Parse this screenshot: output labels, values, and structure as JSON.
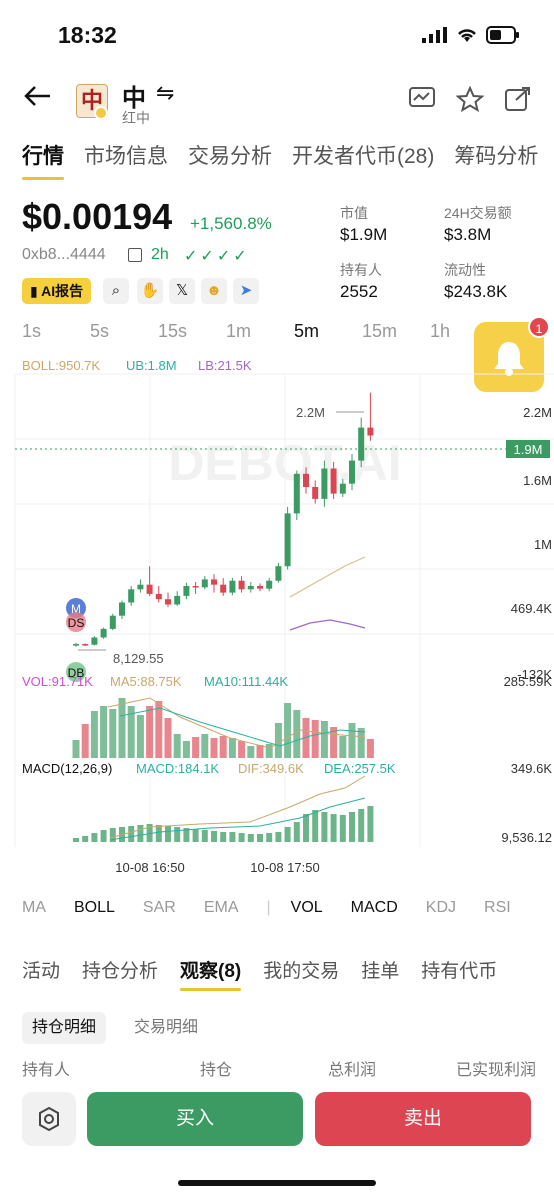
{
  "status": {
    "time": "18:32"
  },
  "header": {
    "token_name": "中",
    "token_sub": "红中",
    "logo_char": "中"
  },
  "main_tabs": [
    "行情",
    "市场信息",
    "交易分析",
    "开发者代币(28)",
    "筹码分析"
  ],
  "price": {
    "value": "$0.00194",
    "change": "+1,560.8%",
    "address": "0xb8...4444",
    "age": "2h",
    "checks": "✓✓✓✓"
  },
  "stats": {
    "market_cap_label": "市值",
    "market_cap": "$1.9M",
    "volume_label": "24H交易额",
    "volume": "$3.8M",
    "holders_label": "持有人",
    "holders": "2552",
    "liquidity_label": "流动性",
    "liquidity": "$243.8K"
  },
  "tools": {
    "ai_label": "AI报告"
  },
  "intervals": [
    "1s",
    "5s",
    "15s",
    "1m",
    "5m",
    "15m",
    "1h"
  ],
  "active_interval": "5m",
  "notification_count": "1",
  "chart_data": {
    "type": "candlestick",
    "watermark": "DEBOT.AI",
    "boll_label": "BOLL:950.7K",
    "ub_label": "UB:1.8M",
    "lb_label": "LB:21.5K",
    "y_ticks": [
      "2.2M",
      "1.6M",
      "1M",
      "469.4K",
      "-132K"
    ],
    "current_price": "1.9M",
    "high_marker": "2.2M",
    "low_marker": "8,129.55",
    "vol_label": "VOL:91.71K",
    "ma5_label": "MA5:88.75K",
    "ma10_label": "MA10:111.44K",
    "vol_max": "285.59K",
    "macd_label": "MACD(12,26,9)",
    "macd_val": "MACD:184.1K",
    "dif_val": "DIF:349.6K",
    "dea_val": "DEA:257.5K",
    "macd_top": "349.6K",
    "macd_bottom": "9,536.12",
    "x_labels": [
      "10-08 16:50",
      "10-08 17:50"
    ],
    "candles": [
      [
        10,
        12,
        8,
        14
      ],
      [
        12,
        11,
        9,
        13
      ],
      [
        11,
        22,
        10,
        24
      ],
      [
        22,
        35,
        20,
        37
      ],
      [
        35,
        55,
        33,
        58
      ],
      [
        55,
        75,
        50,
        78
      ],
      [
        75,
        95,
        70,
        100
      ],
      [
        95,
        102,
        90,
        110
      ],
      [
        102,
        88,
        85,
        130
      ],
      [
        88,
        80,
        75,
        100
      ],
      [
        80,
        72,
        68,
        90
      ],
      [
        72,
        85,
        70,
        92
      ],
      [
        85,
        100,
        80,
        105
      ],
      [
        100,
        98,
        88,
        106
      ],
      [
        98,
        110,
        95,
        115
      ],
      [
        110,
        102,
        90,
        118
      ],
      [
        102,
        90,
        85,
        112
      ],
      [
        90,
        108,
        86,
        112
      ],
      [
        108,
        95,
        90,
        115
      ],
      [
        95,
        100,
        90,
        106
      ],
      [
        100,
        96,
        92,
        104
      ],
      [
        96,
        108,
        92,
        112
      ],
      [
        108,
        130,
        105,
        135
      ],
      [
        130,
        210,
        125,
        220
      ],
      [
        210,
        270,
        200,
        275
      ],
      [
        270,
        250,
        240,
        280
      ],
      [
        250,
        232,
        225,
        260
      ],
      [
        232,
        278,
        220,
        290
      ],
      [
        278,
        240,
        232,
        288
      ],
      [
        240,
        255,
        235,
        262
      ],
      [
        255,
        290,
        245,
        300
      ],
      [
        290,
        340,
        280,
        355
      ],
      [
        340,
        328,
        320,
        393
      ]
    ],
    "volumes": [
      18,
      34,
      47,
      52,
      49,
      60,
      52,
      43,
      52,
      57,
      40,
      24,
      17,
      21,
      24,
      20,
      22,
      20,
      17,
      12,
      13,
      14,
      35,
      55,
      48,
      40,
      38,
      37,
      31,
      22,
      35,
      30,
      19
    ],
    "vol_colors": "mixed",
    "macd_bars": [
      4,
      6,
      9,
      12,
      14,
      15,
      16,
      17,
      18,
      17,
      16,
      15,
      14,
      13,
      12,
      11,
      10,
      10,
      9,
      8,
      8,
      9,
      10,
      15,
      20,
      28,
      32,
      30,
      28,
      27,
      30,
      33,
      36
    ]
  },
  "indicator_tabs": [
    "MA",
    "BOLL",
    "SAR",
    "EMA",
    "VOL",
    "MACD",
    "KDJ",
    "RSI"
  ],
  "indicator_active": [
    "BOLL",
    "VOL",
    "MACD"
  ],
  "bottom_tabs": [
    "活动",
    "持仓分析",
    "观察(8)",
    "我的交易",
    "挂单",
    "持有代币"
  ],
  "sub_tabs": {
    "active": "持仓明细",
    "other": "交易明细"
  },
  "columns": [
    "持有人",
    "持仓",
    "总利润",
    "已实现利润"
  ],
  "actions": {
    "buy": "买入",
    "sell": "卖出"
  },
  "colors": {
    "up": "#3b9b63",
    "down": "#dc4551",
    "accent": "#f5cf3e"
  }
}
